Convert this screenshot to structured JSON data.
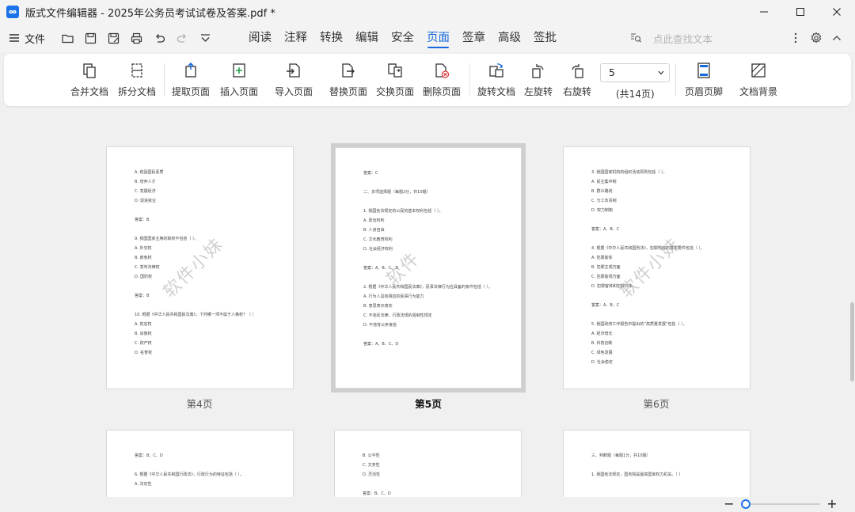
{
  "window": {
    "title": "版式文件编辑器 - 2025年公务员考试试卷及答案.pdf *"
  },
  "menubar": {
    "file_label": "文件",
    "quick_tools": [
      "open-folder-icon",
      "save-icon",
      "save-as-icon",
      "print-icon",
      "undo-icon",
      "redo-icon",
      "more-dropdown-icon"
    ],
    "tabs": [
      {
        "label": "阅读",
        "active": false
      },
      {
        "label": "注释",
        "active": false
      },
      {
        "label": "转换",
        "active": false
      },
      {
        "label": "编辑",
        "active": false
      },
      {
        "label": "安全",
        "active": false
      },
      {
        "label": "页面",
        "active": true
      },
      {
        "label": "签章",
        "active": false
      },
      {
        "label": "高级",
        "active": false
      },
      {
        "label": "签批",
        "active": false
      }
    ],
    "search_placeholder": "点此查找文本"
  },
  "ribbon": {
    "merge": "合并文档",
    "split": "拆分文档",
    "extract": "提取页面",
    "insert": "插入页面",
    "import": "导入页面",
    "replace": "替换页面",
    "swap": "交换页面",
    "delete": "删除页面",
    "rotate_doc": "旋转文档",
    "rotate_left": "左旋转",
    "rotate_right": "右旋转",
    "page_value": "5",
    "page_total": "(共14页)",
    "header_footer": "页眉页脚",
    "background": "文档背景"
  },
  "pages": [
    {
      "label": "第4页",
      "active": false,
      "lines": [
        "A. 稳固国民素质",
        "B. 培养人才",
        "C. 发展经济",
        "D. 促进就业",
        "",
        "答案：B",
        "",
        "9. 我国国家主席的职权不包括（ ）。",
        "A. 外交权",
        "B. 赦免权",
        "C. 发布法律权",
        "D. 国防权",
        "",
        "答案：B",
        "",
        "10. 根据《中华人民共和国民法典》，下列哪一项不属于人格权？（ ）",
        "A. 姓名权",
        "B. 肖像权",
        "C. 财产权",
        "D. 名誉权"
      ],
      "watermark": "软件小妹"
    },
    {
      "label": "第5页",
      "active": true,
      "lines": [
        "答案：C",
        "",
        "二、多项选择题（每题2分，共10题）",
        "",
        "1. 我国宪法规定的公民的基本权利包括（ ）。",
        "A. 政治权利",
        "B. 人身自由",
        "C. 文化教育权利",
        "D. 社会经济权利",
        "",
        "答案：A、B、C、D",
        "",
        "2. 根据《中华人民共和国民法典》，民事法律行为应具备的条件包括（ ）。",
        "A. 行为人具有相应的民事行为能力",
        "B. 意思表示真实",
        "C. 不违反法律、行政法规的强制性规定",
        "D. 不违背公序良俗",
        "",
        "答案：A、B、C、D"
      ],
      "watermark": "软件"
    },
    {
      "label": "第6页",
      "active": false,
      "lines": [
        "3. 我国国家机构的组织活动原则包括（ ）。",
        "A. 民主集中制",
        "B. 群众路线",
        "C. 分工负责制",
        "D. 权力制衡",
        "",
        "答案：A、B、C",
        "",
        "4. 根据《中华人民共和国刑法》，犯罪构成的基本要件包括（ ）。",
        "A. 犯罪客体",
        "B. 犯罪主观方面",
        "C. 犯罪客观方面",
        "D. 犯罪客体和犯罪对象",
        "",
        "答案：A、B、C",
        "",
        "5. 我国政府工作报告中提出的“高质量发展”包括（ ）。",
        "A. 经济增长",
        "B. 科技创新",
        "C. 绿色发展",
        "D. 社会稳定"
      ],
      "watermark": "软件小妹"
    },
    {
      "label": "",
      "active": false,
      "lines": [
        "答案：B、C、D",
        "",
        "6. 根据《中华人民共和国行政法》，行政行为的特征包括（ ）。",
        "A. 法定性"
      ],
      "watermark": ""
    },
    {
      "label": "",
      "active": false,
      "lines": [
        "B. 公平性",
        "C. 文务性",
        "D. 灵活性",
        "",
        "答案：B、C、D"
      ],
      "watermark": ""
    },
    {
      "label": "",
      "active": false,
      "lines": [
        "三、判断题（每题1分，共10题）",
        "",
        "1. 我国宪法规定，国务院是最高国家权力机关。（ ）"
      ],
      "watermark": ""
    }
  ],
  "status": {
    "zoom_minus": "−",
    "zoom_plus": "+",
    "zoom_fraction": 0.06
  },
  "colors": {
    "accent": "#1668dc",
    "selection_frame": "#cfcfcf"
  }
}
